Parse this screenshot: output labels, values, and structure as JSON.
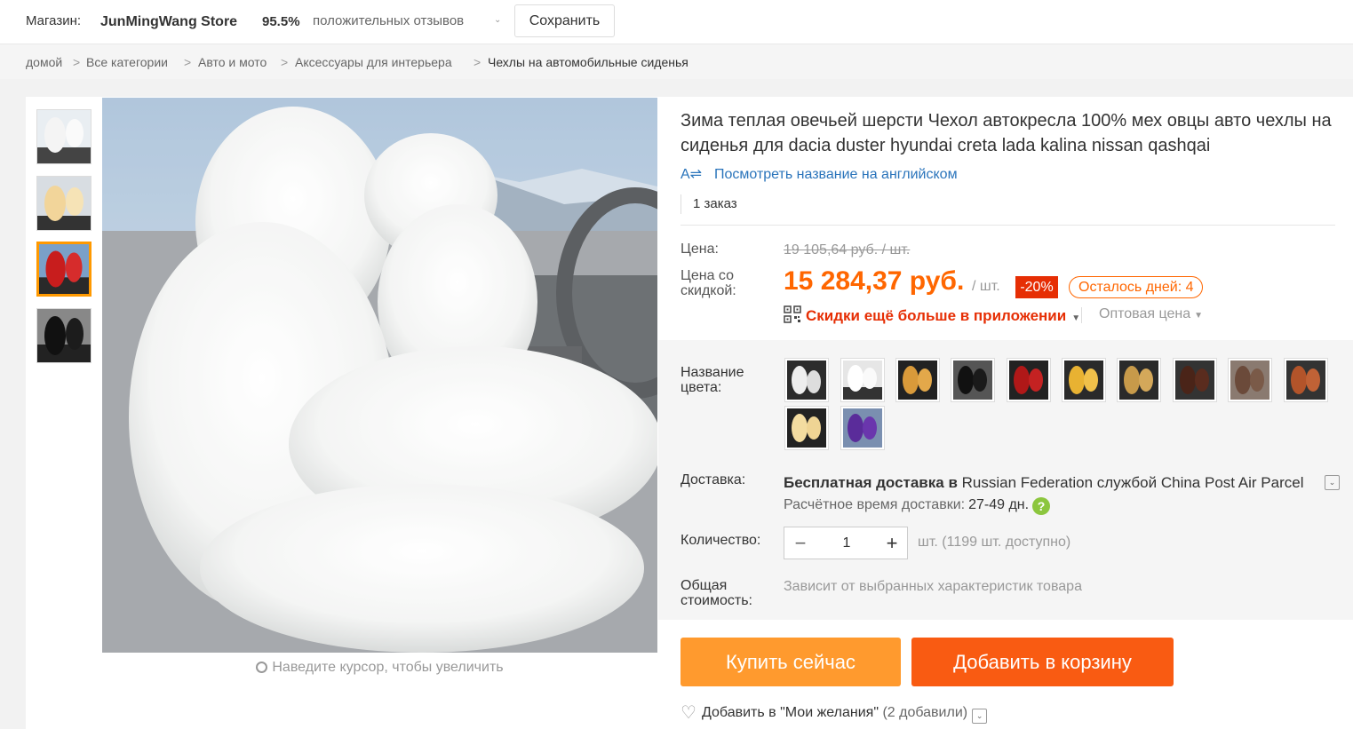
{
  "store": {
    "label": "Магазин:",
    "name": "JunMingWang Store",
    "rating": "95.5%",
    "rating_text": "положительных отзывов",
    "save_label": "Сохранить"
  },
  "breadcrumb": [
    "домой",
    "Все категории",
    "Авто и мото",
    "Аксессуары для интерьера",
    "Чехлы на автомобильные сиденья"
  ],
  "breadcrumb_sep": ">",
  "gallery": {
    "zoom_hint": "Наведите курсор, чтобы увеличить"
  },
  "product": {
    "title": "Зима теплая овечьей шерсти Чехол автокресла 100% мех овцы авто чехлы на сиденья для dacia duster hyundai creta lada kalina nissan qashqai",
    "translate_link": "Посмотреть название на английском",
    "orders": "1 заказ",
    "price_label": "Цена:",
    "old_price": "19 105,64 руб. / шт.",
    "discount_price_label": "Цена со скидкой:",
    "new_price": "15 284,37 руб.",
    "per_unit": "/ шт.",
    "discount": "-20%",
    "days_left": "Осталось дней: 4",
    "app_promo": "Скидки ещё больше в приложении",
    "wholesale": "Оптовая цена",
    "color_label": "Название цвета:",
    "shipping_label": "Доставка:",
    "shipping_free": "Бесплатная доставка в",
    "shipping_dest": "Russian Federation службой China Post Air Parcel",
    "shipping_time_label": "Расчётное время доставки:",
    "shipping_time": "27-49 дн.",
    "qty_label": "Количество:",
    "qty_value": "1",
    "qty_avail": "шт. (1199 шт. доступно)",
    "total_label": "Общая стоимость:",
    "total_value": "Зависит от выбранных характеристик товара",
    "buy_label": "Купить сейчас",
    "cart_label": "Добавить в корзину",
    "wishlist_label": "Добавить в \"Мои желания\"",
    "wishlist_count": "(2 добавили)"
  },
  "colors": {
    "accent": "#ff6600",
    "sale": "#e62e04",
    "buy": "#ff9a2e",
    "cart": "#f95b12",
    "link": "#2a74bb"
  }
}
